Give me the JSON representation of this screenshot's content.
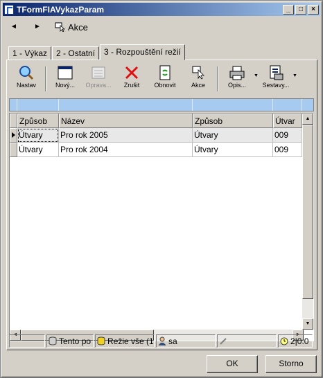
{
  "window": {
    "title": "TFormFIAVykazParam"
  },
  "nav": {
    "back_glyph": "◄",
    "forward_glyph": "►",
    "akce_label": "Akce"
  },
  "tabs": [
    {
      "label": "1 - Výkaz"
    },
    {
      "label": "2 - Ostatní"
    },
    {
      "label": "3 - Rozpouštění režií"
    }
  ],
  "toolbar": {
    "nastav": "Nastav",
    "novy": "Nový...",
    "oprava": "Oprava...",
    "zrusit": "Zrušit",
    "obnovit": "Obnovit",
    "akce": "Akce",
    "opis": "Opis...",
    "sestavy": "Sestavy..."
  },
  "grid": {
    "columns": [
      "Způsob",
      "Název",
      "Způsob",
      "Útvar"
    ],
    "rows": [
      [
        "Útvary",
        "Pro rok 2005",
        "Útvary",
        "009"
      ],
      [
        "Útvary",
        "Pro rok 2004",
        "Útvary",
        "009"
      ]
    ]
  },
  "status": {
    "p2": "Tento po",
    "p3": "Režie vše (1",
    "p4": "sa",
    "p6": "2|0:0"
  },
  "buttons": {
    "ok": "OK",
    "cancel": "Storno"
  }
}
